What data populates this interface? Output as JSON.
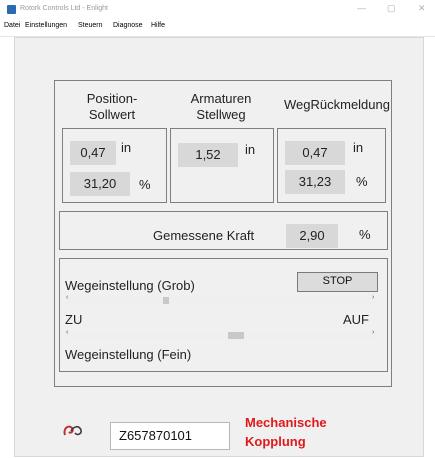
{
  "window": {
    "title": "Rotork Controls Ltd - Enlight",
    "minimize": "—",
    "maximize": "▢",
    "close": "✕"
  },
  "menu": [
    "Datei",
    "Einstellungen",
    "Steuern",
    "Diagnose",
    "Hilfe"
  ],
  "position_panel": {
    "header_line1": "Position-",
    "header_line2": "Sollwert",
    "value_in": "0,47",
    "unit_in": "in",
    "value_pct": "31,20",
    "unit_pct": "%"
  },
  "armaturen_panel": {
    "header_line1": "Armaturen",
    "header_line2": "Stellweg",
    "value_in": "1,52",
    "unit_in": "in"
  },
  "feedback_panel": {
    "header": "WegRückmeldung",
    "value_in": "0,47",
    "unit_in": "in",
    "value_pct": "31,23",
    "unit_pct": "%"
  },
  "force": {
    "label": "Gemessene Kraft",
    "value": "2,90",
    "unit": "%"
  },
  "adjust": {
    "coarse_label": "Wegeinstellung (Grob)",
    "stop_label": "STOP",
    "zu_label": "ZU",
    "auf_label": "AUF",
    "fine_label": "Wegeinstellung (Fein)",
    "coarse_position": 0.31,
    "fine_position": 0.55,
    "arrow_left": "‹",
    "arrow_right": "›"
  },
  "footer": {
    "serial": "Z657870101",
    "mech_line1": "Mechanische",
    "mech_line2": "Kopplung"
  },
  "colors": {
    "accent_red": "#e01a1a",
    "value_bg": "#d8d8d8",
    "panel_bg": "#f0f0f0"
  }
}
